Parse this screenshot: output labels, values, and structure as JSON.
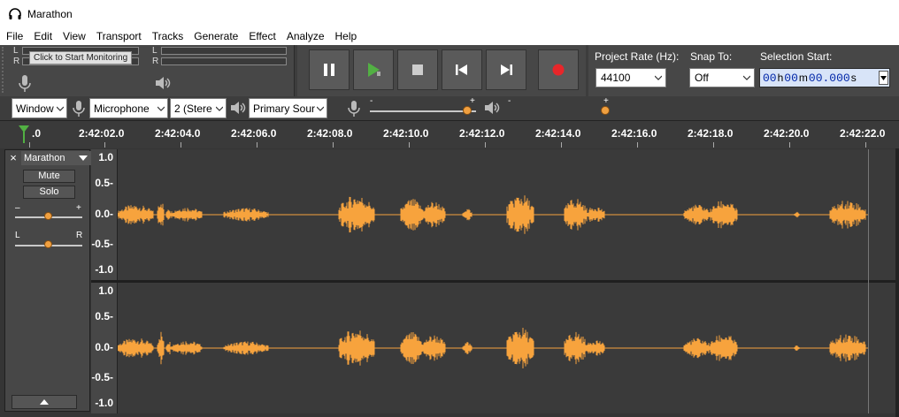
{
  "window": {
    "title": "Marathon"
  },
  "menu": [
    "File",
    "Edit",
    "View",
    "Transport",
    "Tracks",
    "Generate",
    "Effect",
    "Analyze",
    "Help"
  ],
  "meter": {
    "left_label": "L",
    "right_label": "R",
    "monitor_button": "Click to Start Monitoring"
  },
  "transport": {
    "buttons": [
      "pause-button",
      "play-button",
      "stop-button",
      "skip-to-start-button",
      "skip-to-end-button",
      "record-button"
    ]
  },
  "project_rate": {
    "label": "Project Rate (Hz):",
    "value": "44100"
  },
  "snap_to": {
    "label": "Snap To:",
    "value": "Off"
  },
  "selection_start": {
    "label": "Selection Start:",
    "hours": "00",
    "h": "h",
    "minutes": "00",
    "m": "m",
    "seconds": "00.000",
    "s": "s"
  },
  "devices": {
    "host": "Window",
    "input": "Microphone",
    "channels": "2 (Stere",
    "output": "Primary Sour"
  },
  "sliders": {
    "minus": "-",
    "plus": "+",
    "recording_level": 0.92,
    "playback_level": 0.92
  },
  "ruler": {
    "labels": [
      ".0",
      "2:42:02.0",
      "2:42:04.0",
      "2:42:06.0",
      "2:42:08.0",
      "2:42:10.0",
      "2:42:12.0",
      "2:42:14.0",
      "2:42:16.0",
      "2:42:18.0",
      "2:42:20.0",
      "2:42:22.0"
    ]
  },
  "track": {
    "name": "Marathon",
    "close": "×",
    "mute": "Mute",
    "solo": "Solo",
    "gain_minus": "–",
    "gain_plus": "+",
    "pan_left": "L",
    "pan_right": "R",
    "gain_level": 0.5,
    "pan_level": 0.5
  },
  "vscale": [
    "1.0",
    "0.5-",
    "0.0-",
    "-0.5-",
    "-1.0"
  ],
  "colors": {
    "waveform": "#f7a33d",
    "background": "#3a3a3a",
    "panel": "#474747",
    "record": "#e8262a",
    "play": "#52b043"
  }
}
